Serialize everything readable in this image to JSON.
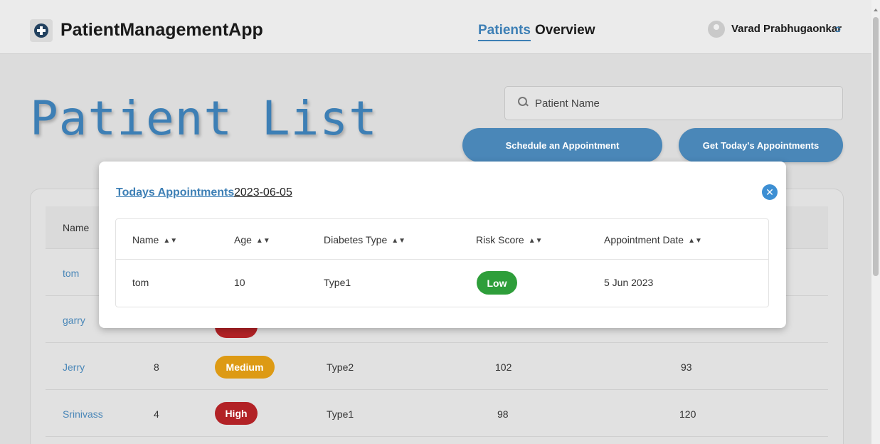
{
  "navbar": {
    "app_name": "PatientManagementApp",
    "links": [
      "Patients",
      "Overview"
    ],
    "active_link": "Patients",
    "user_name": "Varad Prabhugaonkar"
  },
  "page": {
    "title": "Patient List",
    "search_placeholder": "Patient Name",
    "schedule_button": "Schedule an Appointment",
    "today_button": "Get Today's Appointments"
  },
  "background_table": {
    "header_first": "Name",
    "rows": [
      {
        "name": "tom"
      },
      {
        "name": "garry"
      },
      {
        "name": "Jerry",
        "age": "8",
        "risk": "Medium",
        "diabetes": "Type2",
        "col5": "102",
        "col6": "93"
      },
      {
        "name": "Srinivass",
        "age": "4",
        "risk": "High",
        "diabetes": "Type1",
        "col5": "98",
        "col6": "120"
      }
    ]
  },
  "modal": {
    "title": "Todays Appointments",
    "date": "2023-06-05",
    "columns": [
      "Name",
      "Age",
      "Diabetes Type",
      "Risk Score",
      "Appointment Date"
    ],
    "rows": [
      {
        "name": "tom",
        "age": "10",
        "diabetes": "Type1",
        "risk": "Low",
        "appointment": "5 Jun 2023"
      }
    ]
  },
  "colors": {
    "accent": "#3d7fb5",
    "button": "#4a87b8",
    "risk_low": "#2e9e3a",
    "risk_medium": "#dd9a14",
    "risk_high": "#b22226"
  },
  "icons": [
    "medical-cross-icon",
    "user-avatar-icon",
    "logout-icon",
    "search-icon",
    "close-icon",
    "sort-icon"
  ]
}
